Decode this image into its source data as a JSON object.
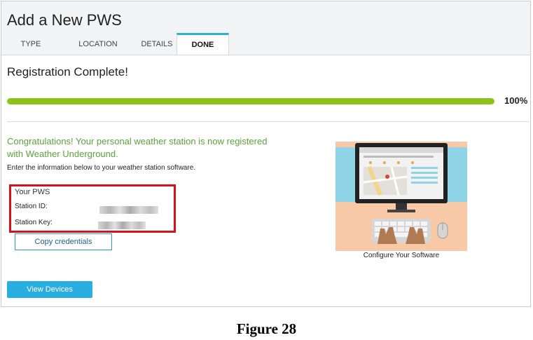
{
  "header": {
    "title": "Add a New PWS",
    "tabs": [
      {
        "label": "TYPE",
        "active": false
      },
      {
        "label": "LOCATION",
        "active": false
      },
      {
        "label": "DETAILS",
        "active": false
      },
      {
        "label": "DONE",
        "active": true
      }
    ]
  },
  "registration": {
    "title": "Registration Complete!",
    "progress_percent": 100,
    "progress_label": "100%"
  },
  "message": {
    "congratulations": "Congratulations! Your personal weather station is now registered with Weather Underground.",
    "instructions": "Enter the information below to your weather station software."
  },
  "pws": {
    "heading": "Your PWS",
    "station_id_label": "Station ID:",
    "station_key_label": "Station Key:"
  },
  "buttons": {
    "copy_credentials": "Copy credentials",
    "view_devices": "View Devices"
  },
  "illustration": {
    "caption": "Configure Your Software"
  },
  "figure_caption": "Figure 28",
  "colors": {
    "accent": "#29aee1",
    "progress": "#8cc21a",
    "success_text": "#5aa33a",
    "highlight_border": "#d3121c"
  }
}
